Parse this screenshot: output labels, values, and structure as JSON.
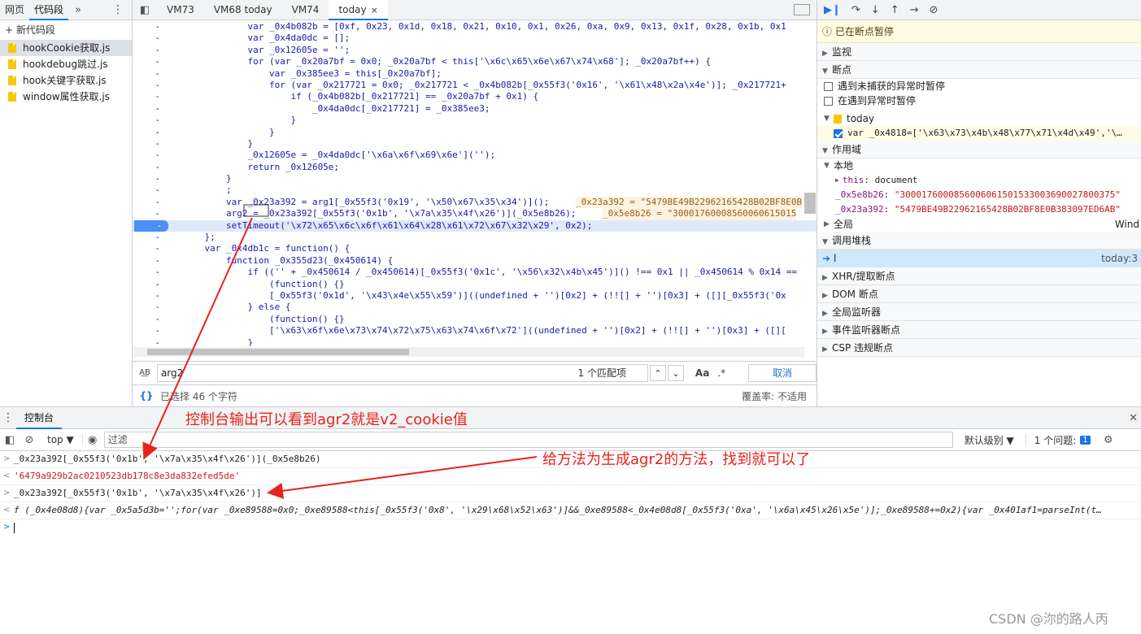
{
  "navigator": {
    "tabs": [
      "网页",
      "代码段"
    ],
    "more": "»",
    "new_snippet": "+ 新代码段",
    "files": [
      "hookCookie获取.js",
      "hookdebug跳过.js",
      "hook关键字获取.js",
      "window属性获取.js"
    ]
  },
  "editor": {
    "tabs": [
      "VM73",
      "VM68 today",
      "VM74",
      "today"
    ],
    "close_glyph": "×",
    "lines": [
      {
        "t": "            var _0x4b082b = [0xf, 0x23, 0x1d, 0x18, 0x21, 0x10, 0x1, 0x26, 0xa, 0x9, 0x13, 0x1f, 0x28, 0x1b, 0x1"
      },
      {
        "t": "            var _0x4da0dc = [];"
      },
      {
        "t": "            var _0x12605e = '';"
      },
      {
        "t": "            for (var _0x20a7bf = 0x0; _0x20a7bf < this['\\x6c\\x65\\x6e\\x67\\x74\\x68']; _0x20a7bf++) {"
      },
      {
        "t": "                var _0x385ee3 = this[_0x20a7bf];"
      },
      {
        "t": "                for (var _0x217721 = 0x0; _0x217721 < _0x4b082b[_0x55f3('0x16', '\\x61\\x48\\x2a\\x4e')]; _0x217721+"
      },
      {
        "t": "                    if (_0x4b082b[_0x217721] == _0x20a7bf + 0x1) {"
      },
      {
        "t": "                        _0x4da0dc[_0x217721] = _0x385ee3;"
      },
      {
        "t": "                    }"
      },
      {
        "t": "                }"
      },
      {
        "t": "            }"
      },
      {
        "t": "            _0x12605e = _0x4da0dc['\\x6a\\x6f\\x69\\x6e']('');"
      },
      {
        "t": "            return _0x12605e;"
      },
      {
        "t": "        }"
      },
      {
        "t": "        ;"
      },
      {
        "t": "        var _0x23a392 = arg1[_0x55f3('0x19', '\\x50\\x67\\x35\\x34')]();",
        "v": "_0x23a392 = \"5479BE49B22962165428B02BF8E0B"
      },
      {
        "t": "        arg2 = _0x23a392[_0x55f3('0x1b', '\\x7a\\x35\\x4f\\x26')](_0x5e8b26);",
        "v": "_0x5e8b26 = \"30001760008560060615015"
      },
      {
        "t": "        setTimeout('\\x72\\x65\\x6c\\x6f\\x61\\x64\\x28\\x61\\x72\\x67\\x32\\x29', 0x2);",
        "hl": true
      },
      {
        "t": "    };"
      },
      {
        "t": "    var _0x4db1c = function() {"
      },
      {
        "t": "        function _0x355d23(_0x450614) {"
      },
      {
        "t": "            if (('' + _0x450614 / _0x450614)[_0x55f3('0x1c', '\\x56\\x32\\x4b\\x45')]() !== 0x1 || _0x450614 % 0x14 =="
      },
      {
        "t": "                (function() {}"
      },
      {
        "t": "                [_0x55f3('0x1d', '\\x43\\x4e\\x55\\x59')]((undefined + '')[0x2] + (!![] + '')[0x3] + ([][_0x55f3('0x"
      },
      {
        "t": "            } else {"
      },
      {
        "t": "                (function() {}"
      },
      {
        "t": "                ['\\x63\\x6f\\x6e\\x73\\x74\\x72\\x75\\x63\\x74\\x6f\\x72']((undefined + '')[0x2] + (!![] + '')[0x3] + ([]["
      },
      {
        "t": "            }"
      }
    ],
    "gutter_mark": "-",
    "search": {
      "value": "arg2",
      "matches": "1 个匹配项",
      "case": "Aa",
      "regex": ".*",
      "cancel": "取消"
    },
    "status": {
      "braces": "{}",
      "selection": "已选择 46 个字符",
      "coverage": "覆盖率: 不适用"
    }
  },
  "debugger": {
    "paused": "已在断点暂停",
    "sections": {
      "watch": "监视",
      "breakpoints": "断点",
      "scope": "作用域",
      "global": "全局",
      "callstack": "调用堆栈",
      "xhr": "XHR/提取断点",
      "dom": "DOM 断点",
      "global_listeners": "全局监听器",
      "event_listeners": "事件监听器断点",
      "csp": "CSP 违规断点"
    },
    "pause_uncaught": "遇到未捕获的异常时暂停",
    "pause_caught": "在遇到异常时暂停",
    "bp_file": "today",
    "bp_line": "var _0x4818=['\\x63\\x73\\x4b\\x48\\x77\\x71\\x4d\\x49','\\…",
    "local": "本地",
    "this_key": "this",
    "this_val": "document",
    "scope_vars": [
      {
        "k": "_0x5e8b26",
        "v": "\"3000176000856006061501533003690027800375\""
      },
      {
        "k": "_0x23a392",
        "v": "\"5479BE49B22962165428B02BF8E0B383097ED6AB\""
      }
    ],
    "global_val": "Wind",
    "call_frame": "l",
    "call_loc": "today:3"
  },
  "console": {
    "tab": "控制台",
    "context": "top ▼",
    "filter_placeholder": "过滤",
    "level": "默认级别 ▼",
    "issues": "1 个问题:",
    "issue_count": "1",
    "lines": [
      {
        "p": ">",
        "t": "_0x23a392[_0x55f3('0x1b', '\\x7a\\x35\\x4f\\x26')](_0x5e8b26)"
      },
      {
        "p": "<",
        "t": "'6479a929b2ac0210523db178c8e3da832efed5de'",
        "cls": "res"
      },
      {
        "p": ">",
        "t": "_0x23a392[_0x55f3('0x1b', '\\x7a\\x35\\x4f\\x26')]"
      },
      {
        "p": "<",
        "t": "f (_0x4e08d8){var _0x5a5d3b='';for(var _0xe89588=0x0;_0xe89588<this[_0x55f3('0x8', '\\x29\\x68\\x52\\x63')]&&_0xe89588<_0x4e08d8[_0x55f3('0xa', '\\x6a\\x45\\x26\\x5e')];_0xe89588+=0x2){var _0x401af1=parseInt(t…",
        "cls": "fn"
      }
    ],
    "prompt": ">"
  },
  "annotations": {
    "a1": "控制台输出可以看到agr2就是v2_cookie值",
    "a2": "给方法为生成agr2的方法，找到就可以了"
  },
  "watermark": "CSDN @沵的路人丙",
  "colors": {
    "accent": "#1a73e8",
    "annotation": "#e8231d"
  }
}
